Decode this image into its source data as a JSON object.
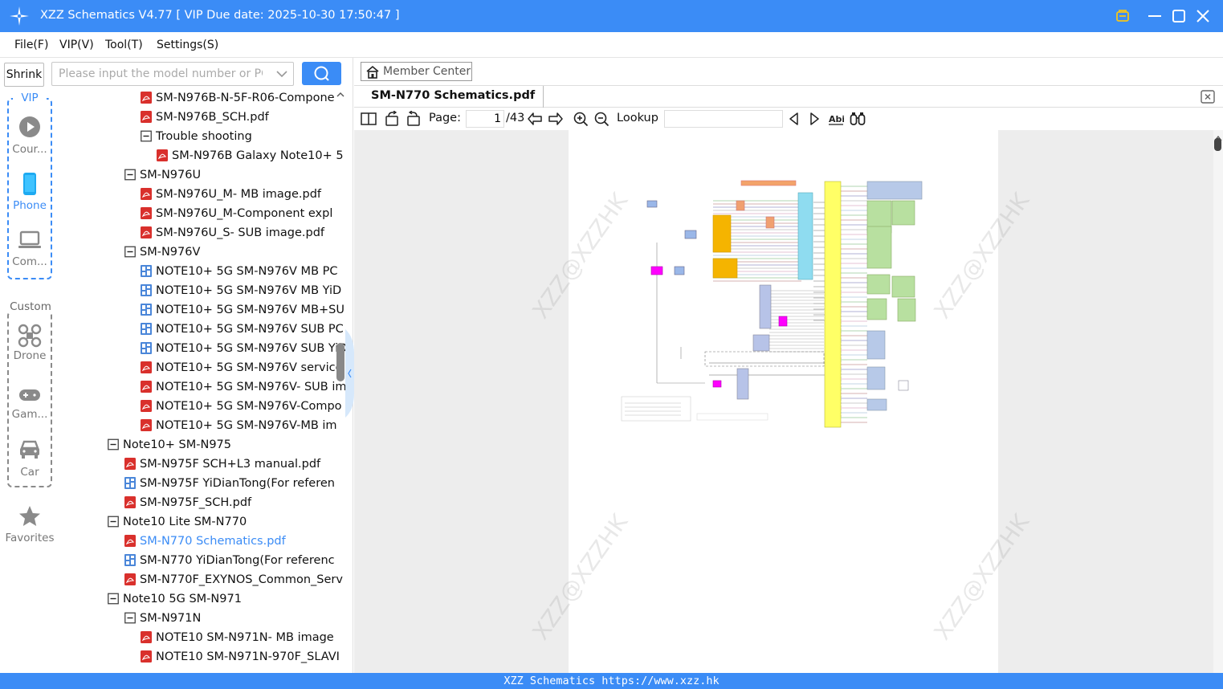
{
  "app": {
    "title": "XZZ Schematics V4.77 [ VIP Due date: 2025-10-30 17:50:47 ]",
    "accent_color": "#3b8cf6"
  },
  "window_controls": [
    "vip-badge-icon",
    "minimize-icon",
    "maximize-icon",
    "close-icon"
  ],
  "menu": [
    "File(F)",
    "VIP(V)",
    "Tool(T)",
    "Settings(S)"
  ],
  "leftnav": {
    "shrink_label": "Shrink",
    "vip_group": {
      "title": "VIP",
      "items": [
        "Cour...",
        "Phone",
        "Com..."
      ]
    },
    "custom_group": {
      "title": "Custom",
      "items": [
        "Drone",
        "Gam...",
        "Car"
      ]
    },
    "favorites": "Favorites",
    "selected": "Phone"
  },
  "search": {
    "placeholder": "Please input the model number or PCB",
    "value": ""
  },
  "tree": {
    "items": [
      {
        "text": "SM-N976B-N-5F-R06-Compone",
        "icon": "pdf",
        "level": 3
      },
      {
        "text": "SM-N976B_SCH.pdf",
        "icon": "pdf",
        "level": 3
      },
      {
        "text": "Trouble shooting",
        "icon": "minus",
        "level": 3
      },
      {
        "text": "SM-N976B Galaxy Note10+ 5",
        "icon": "pdf",
        "level": 4
      },
      {
        "text": "SM-N976U",
        "icon": "minus",
        "level": 2
      },
      {
        "text": "SM-N976U_M- MB image.pdf",
        "icon": "pdf",
        "level": 3
      },
      {
        "text": "SM-N976U_M-Component expl",
        "icon": "pdf",
        "level": 3
      },
      {
        "text": "SM-N976U_S- SUB image.pdf",
        "icon": "pdf",
        "level": 3
      },
      {
        "text": "SM-N976V",
        "icon": "minus",
        "level": 2
      },
      {
        "text": "NOTE10+ 5G SM-N976V MB PC",
        "icon": "board",
        "level": 3
      },
      {
        "text": "NOTE10+ 5G SM-N976V MB YiD",
        "icon": "board",
        "level": 3
      },
      {
        "text": "NOTE10+ 5G SM-N976V MB+SU",
        "icon": "board",
        "level": 3
      },
      {
        "text": "NOTE10+ 5G SM-N976V SUB PC",
        "icon": "board",
        "level": 3
      },
      {
        "text": "NOTE10+ 5G SM-N976V SUB YiD",
        "icon": "board",
        "level": 3
      },
      {
        "text": "NOTE10+ 5G SM-N976V service",
        "icon": "pdf",
        "level": 3
      },
      {
        "text": "NOTE10+ 5G SM-N976V- SUB im",
        "icon": "pdf",
        "level": 3
      },
      {
        "text": "NOTE10+ 5G SM-N976V-Compo",
        "icon": "pdf",
        "level": 3
      },
      {
        "text": "NOTE10+ 5G SM-N976V-MB im",
        "icon": "pdf",
        "level": 3
      },
      {
        "text": "Note10+ SM-N975",
        "icon": "minus",
        "level": 1
      },
      {
        "text": "SM-N975F SCH+L3 manual.pdf",
        "icon": "pdf",
        "level": 2
      },
      {
        "text": "SM-N975F YiDianTong(For referen",
        "icon": "board",
        "level": 2
      },
      {
        "text": "SM-N975F_SCH.pdf",
        "icon": "pdf",
        "level": 2
      },
      {
        "text": "Note10 Lite SM-N770",
        "icon": "minus",
        "level": 1
      },
      {
        "text": "SM-N770 Schematics.pdf",
        "icon": "pdf",
        "level": 2,
        "selected": true
      },
      {
        "text": "SM-N770 YiDianTong(For referenc",
        "icon": "board",
        "level": 2
      },
      {
        "text": "SM-N770F_EXYNOS_Common_Serv",
        "icon": "pdf",
        "level": 2
      },
      {
        "text": "Note10 5G SM-N971",
        "icon": "minus",
        "level": 1
      },
      {
        "text": "SM-N971N",
        "icon": "minus",
        "level": 2
      },
      {
        "text": "NOTE10 SM-N971N- MB image",
        "icon": "pdf",
        "level": 3
      },
      {
        "text": "NOTE10 SM-N971N-970F_SLAVI",
        "icon": "pdf",
        "level": 3
      }
    ]
  },
  "member_center": "Member Center",
  "doc_tab": "SM-N770 Schematics.pdf",
  "toolbar": {
    "page_label": "Page:",
    "page_value": "1",
    "page_total": "/43",
    "lookup_label": "Lookup",
    "lookup_value": ""
  },
  "watermark": "XZZ@XZZHK",
  "status_text": "XZZ Schematics https://www.xzz.hk"
}
